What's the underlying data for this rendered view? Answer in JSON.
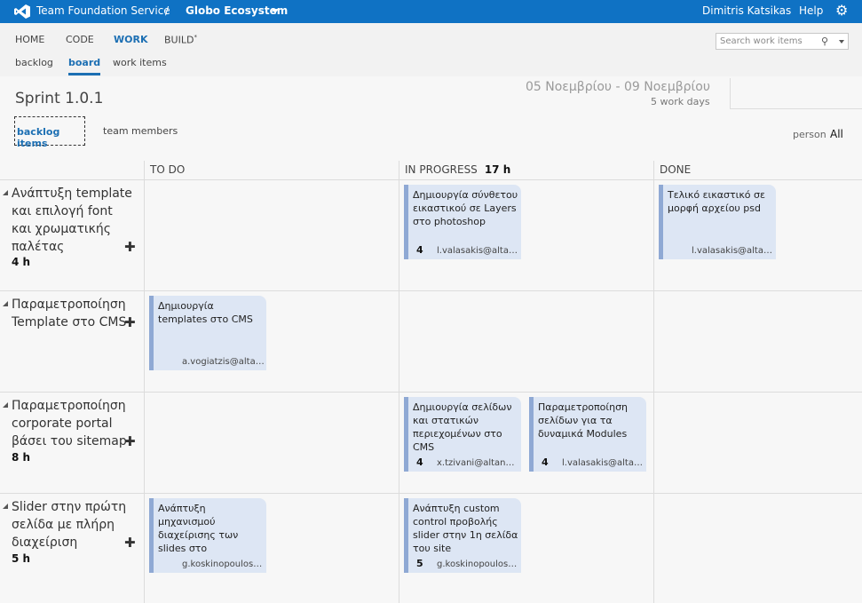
{
  "topbar": {
    "product": "Team Foundation Service",
    "separator": "/",
    "project": "Globo Ecosystem",
    "user": "Dimitris Katsikas",
    "help": "Help",
    "gear_icon": "gear-icon",
    "logo_icon": "visual-studio-logo"
  },
  "nav": {
    "main": [
      {
        "label": "HOME"
      },
      {
        "label": "CODE"
      },
      {
        "label": "WORK",
        "active": true
      },
      {
        "label": "BUILD",
        "sup": "*"
      }
    ],
    "sub": [
      {
        "label": "backlog"
      },
      {
        "label": "board",
        "active": true
      },
      {
        "label": "work items"
      }
    ],
    "search_placeholder": "Search work items"
  },
  "sprint": {
    "title": "Sprint 1.0.1",
    "dates": "05 Νοεμβρίου - 09 Νοεμβρίου",
    "work_days": "5 work days"
  },
  "pivots": {
    "backlog_items": "backlog items",
    "team_members": "team members",
    "filter_label": "person",
    "filter_value": "All"
  },
  "columns": [
    {
      "title": "TO DO",
      "wip": ""
    },
    {
      "title": "IN PROGRESS",
      "wip": "17 h"
    },
    {
      "title": "DONE",
      "wip": ""
    }
  ],
  "rows": [
    {
      "title": "Ανάπτυξη template και επιλογή font και χρωματικής παλέτας",
      "remaining": "4 h",
      "cards": [
        {
          "column": 1,
          "title": "Δημιουργία σύνθετου εικαστικού σε Layers στο photoshop",
          "remaining": "4",
          "assigned": "l.valasakis@altanet.gr"
        },
        {
          "column": 2,
          "title": "Τελικό εικαστικό σε μορφή αρχείου psd",
          "remaining": "",
          "assigned": "l.valasakis@altanet.gr"
        }
      ]
    },
    {
      "title": "Παραμετροποίηση Template στο CMS",
      "remaining": "",
      "cards": [
        {
          "column": 0,
          "title": "Δημιουργία templates στο CMS",
          "remaining": "",
          "assigned": "a.vogiatzis@altanet.gr"
        }
      ]
    },
    {
      "title": "Παραμετροποίηση corporate portal βάσει του sitemap",
      "remaining": "8 h",
      "cards": [
        {
          "column": 1,
          "title": "Δημιουργία σελίδων και στατικών περιεχομένων στο CMS",
          "remaining": "4",
          "assigned": "x.tzivani@altanet.gr"
        },
        {
          "column": 1,
          "title": "Παραμετροποίηση σελίδων για τα δυναμικά Modules",
          "remaining": "4",
          "assigned": "l.valasakis@altanet.gr"
        }
      ]
    },
    {
      "title": "Slider στην πρώτη σελίδα με πλήρη διαχείριση",
      "remaining": "5 h",
      "cards": [
        {
          "column": 0,
          "title": "Ανάπτυξη μηχανισμού διαχείρισης των slides στο",
          "remaining": "",
          "assigned": "g.koskinopoulos@altanet.gr"
        },
        {
          "column": 1,
          "title": "Ανάπτυξη custom control προβολής slider στην 1η σελίδα του site",
          "remaining": "5",
          "assigned": "g.koskinopoulos@altanet.gr"
        }
      ]
    }
  ],
  "colors": {
    "topbar": "#0f72c4",
    "accent": "#1c6fb3",
    "card_bg": "#dde6f4",
    "card_bar": "#8fa9d4"
  }
}
